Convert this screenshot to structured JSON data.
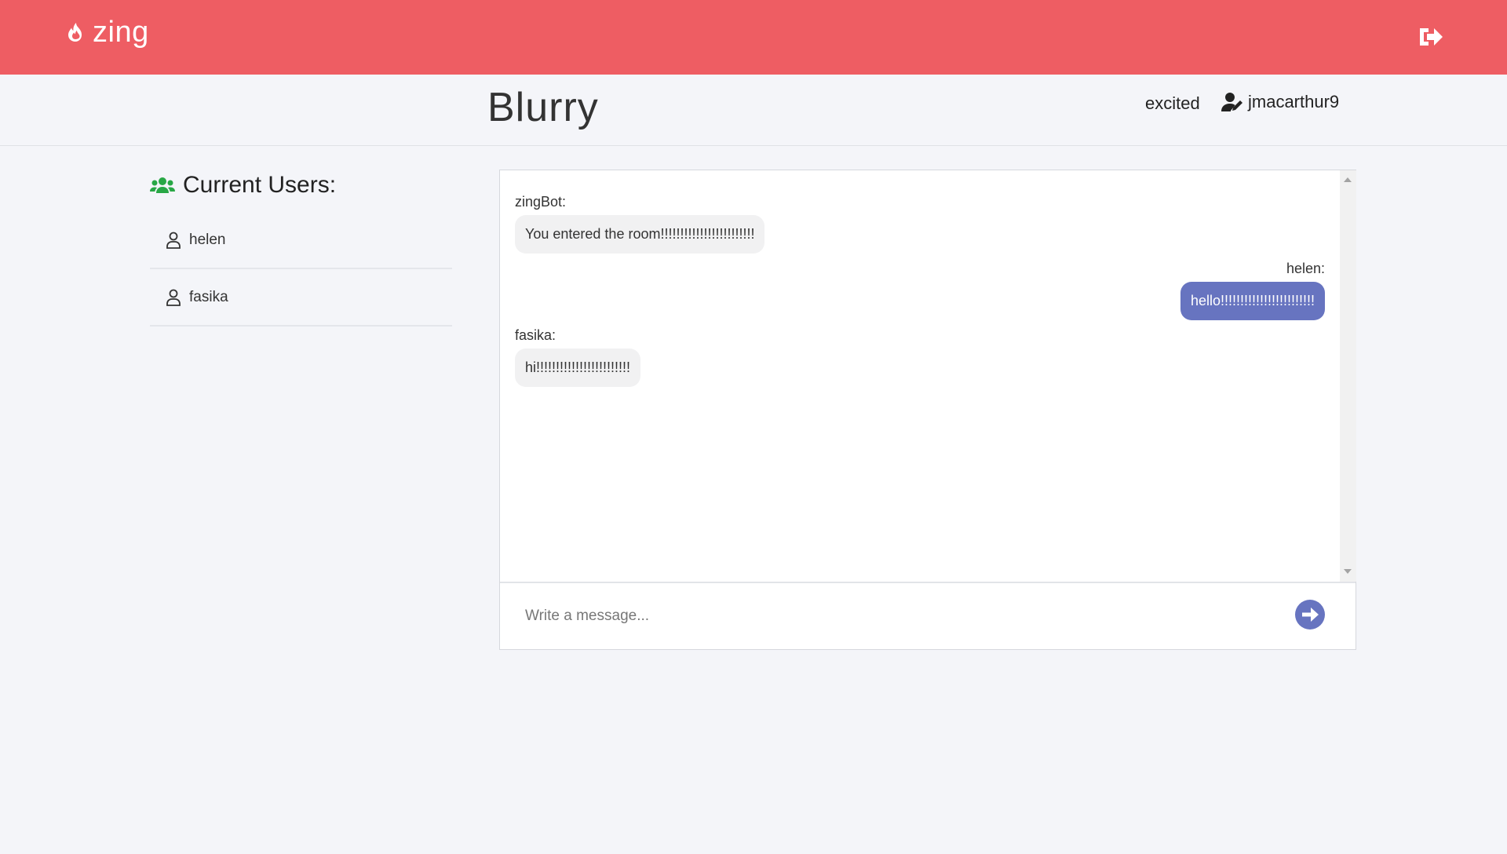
{
  "app": {
    "name": "zing"
  },
  "room": {
    "title": "Blurry",
    "mood": "excited",
    "username": "jmacarthur9"
  },
  "users_panel": {
    "title": "Current Users:",
    "users": [
      {
        "name": "helen"
      },
      {
        "name": "fasika"
      }
    ]
  },
  "messages": [
    {
      "sender": "zingBot:",
      "text": "You entered the room!!!!!!!!!!!!!!!!!!!!!!!!",
      "mine": false
    },
    {
      "sender": "helen:",
      "text": "hello!!!!!!!!!!!!!!!!!!!!!!!!",
      "mine": true
    },
    {
      "sender": "fasika:",
      "text": "hi!!!!!!!!!!!!!!!!!!!!!!!!",
      "mine": false
    }
  ],
  "composer": {
    "placeholder": "Write a message..."
  },
  "colors": {
    "brand": "#ee5d63",
    "accent": "#6774c0",
    "online": "#28a745"
  },
  "icons": {
    "brand": "flame-icon",
    "logout": "sign-out-icon",
    "user_edit": "user-edit-icon",
    "users_group": "users-icon",
    "user": "user-outline-icon",
    "send": "arrow-circle-right-icon"
  }
}
